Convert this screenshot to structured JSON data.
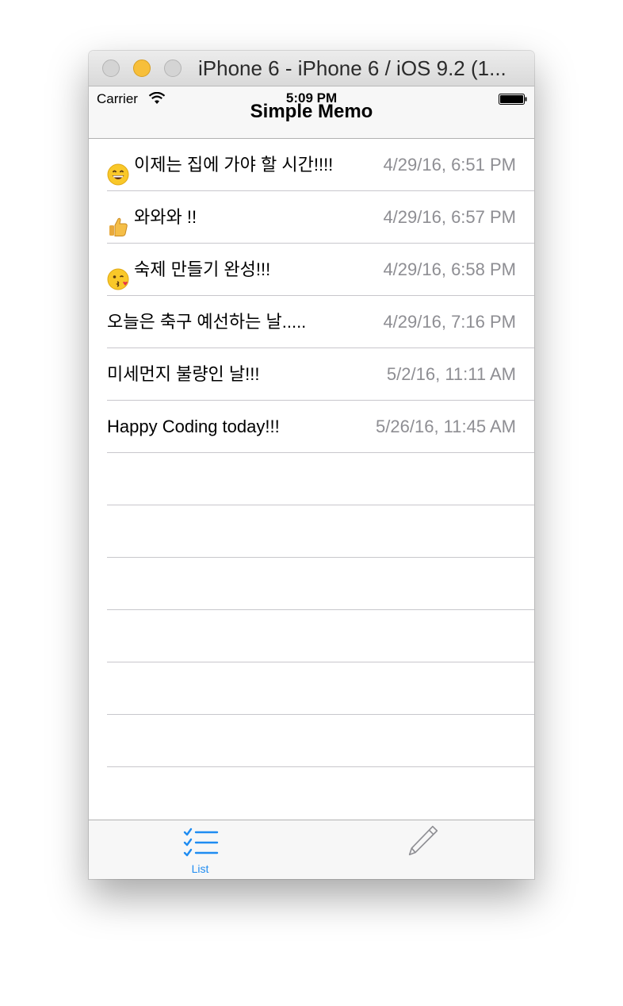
{
  "window": {
    "title": "iPhone 6 - iPhone 6 / iOS 9.2 (1..."
  },
  "status_bar": {
    "carrier": "Carrier",
    "time": "5:09 PM"
  },
  "nav": {
    "title": "Simple Memo"
  },
  "memos": [
    {
      "emoji": "grinning-face-icon",
      "text": "이제는 집에 가야 할 시간!!!!",
      "date": "4/29/16, 6:51 PM"
    },
    {
      "emoji": "thumbs-up-icon",
      "text": "와와와 !!",
      "date": "4/29/16, 6:57 PM"
    },
    {
      "emoji": "kissing-face-icon",
      "text": "숙제 만들기 완성!!!",
      "date": "4/29/16, 6:58 PM"
    },
    {
      "emoji": "",
      "text": "오늘은 축구 예선하는 날.....",
      "date": "4/29/16, 7:16 PM"
    },
    {
      "emoji": "",
      "text": "미세먼지 불량인 날!!!",
      "date": "5/2/16, 11:11 AM"
    },
    {
      "emoji": "",
      "text": "Happy Coding today!!!",
      "date": "5/26/16, 11:45 AM"
    }
  ],
  "empty_rows": 7,
  "tabbar": {
    "tabs": [
      {
        "label": "List",
        "icon": "checklist-icon",
        "selected": true
      },
      {
        "label": "",
        "icon": "pencil-icon",
        "selected": false
      }
    ]
  },
  "colors": {
    "accent": "#1f8cf1",
    "secondary_text": "#8e8e93",
    "separator": "#c8c7cc"
  }
}
